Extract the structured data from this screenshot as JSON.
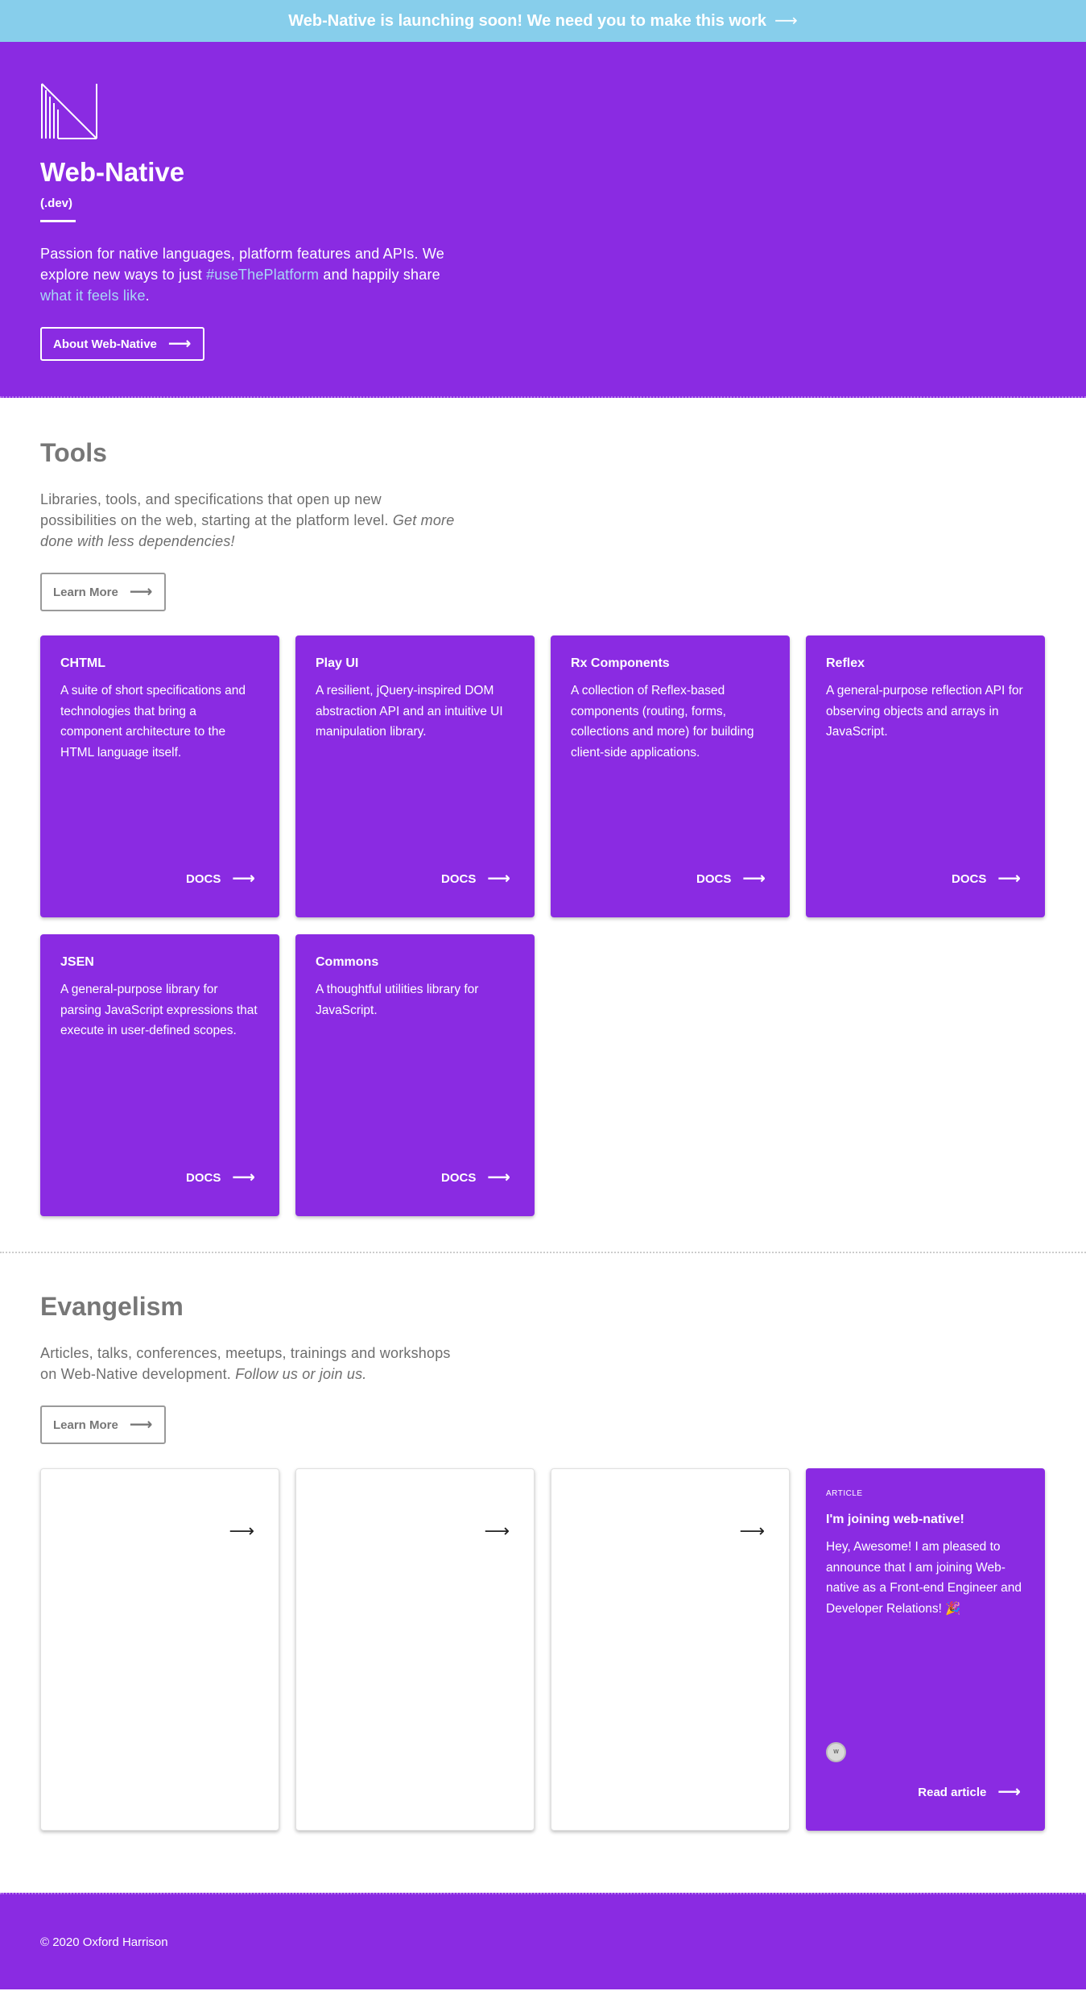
{
  "banner": {
    "text": "Web-Native is launching soon! We need you to make this work",
    "arrow": "⟶"
  },
  "hero": {
    "title": "Web-Native",
    "subtitle": "(.dev)",
    "text_1": "Passion for native languages, platform features and APIs. We explore new ways to just ",
    "link_1": "#useThePlatform",
    "text_2": " and happily share ",
    "link_2": "what it feels like",
    "text_3": ".",
    "button_label": "About Web-Native",
    "button_arrow": "⟶"
  },
  "tools": {
    "title": "Tools",
    "text": "Libraries, tools, and specifications that open up new possibilities on the web, starting at the platform level. ",
    "text_em": "Get more done with less dependencies!",
    "button_label": "Learn More",
    "button_arrow": "⟶",
    "cards": [
      {
        "title": "CHTML",
        "desc": "A suite of short specifications and technologies that bring a component architecture to the HTML language itself.",
        "link": "DOCS",
        "arrow": "⟶"
      },
      {
        "title": "Play UI",
        "desc": "A resilient, jQuery-inspired DOM abstraction API and an intuitive UI manipulation library.",
        "link": "DOCS",
        "arrow": "⟶"
      },
      {
        "title": "Rx Components",
        "desc": "A collection of Reflex-based components (routing, forms, collections and more) for building client-side applications.",
        "link": "DOCS",
        "arrow": "⟶"
      },
      {
        "title": "Reflex",
        "desc": "A general-purpose reflection API for observing objects and arrays in JavaScript.",
        "link": "DOCS",
        "arrow": "⟶"
      },
      {
        "title": "JSEN",
        "desc": "A general-purpose library for parsing JavaScript expressions that execute in user-defined scopes.",
        "link": "DOCS",
        "arrow": "⟶"
      },
      {
        "title": "Commons",
        "desc": "A thoughtful utilities library for JavaScript.",
        "link": "DOCS",
        "arrow": "⟶"
      }
    ]
  },
  "evangelism": {
    "title": "Evangelism",
    "text": "Articles, talks, conferences, meetups, trainings and workshops on Web-Native development. ",
    "text_em": "Follow us or join us.",
    "button_label": "Learn More",
    "button_arrow": "⟶",
    "empty_card_arrow": "⟶",
    "article": {
      "kind": "ARTICLE",
      "title": "I'm joining web-native!",
      "desc": "Hey, Awesome! I am pleased to announce that I am joining Web-native as a Front-end Engineer and Developer Relations! 🎉",
      "avatar_initials": "W",
      "link": "Read article",
      "arrow": "⟶"
    }
  },
  "footer": {
    "text": "© 2020 Oxford Harrison"
  },
  "colors": {
    "brand_purple": "#8a2be2",
    "banner_blue": "#87ceeb",
    "link_blue": "#a8d8f5",
    "grey_text": "#777777"
  }
}
